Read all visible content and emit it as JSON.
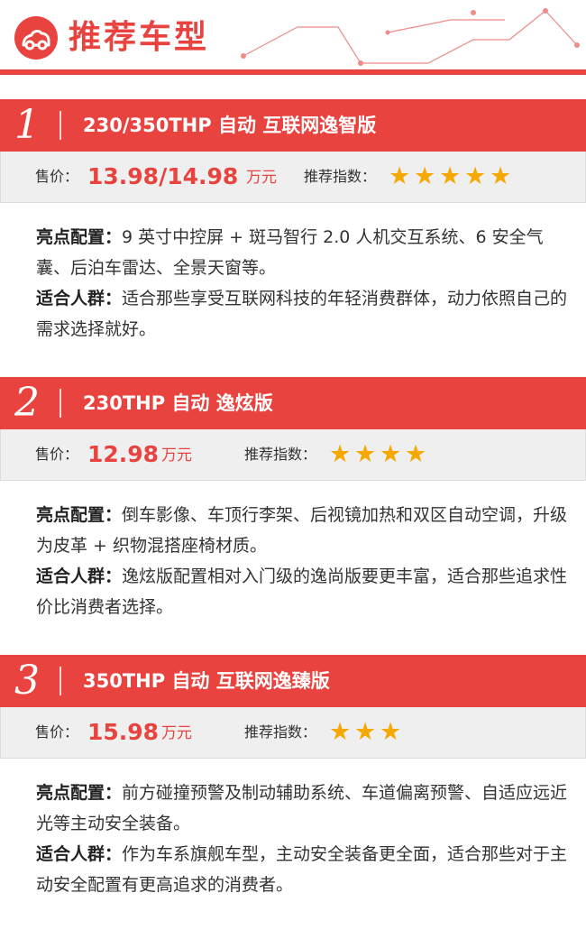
{
  "header": {
    "title": "推荐车型"
  },
  "colors": {
    "accent": "#e8433f",
    "star": "#f5a800"
  },
  "sections": [
    {
      "number": "1",
      "trim": "230/350THP 自动 互联网逸智版",
      "price_label": "售价：",
      "price": "13.98/14.98",
      "price_unit": "万元",
      "rating_label": "推荐指数：",
      "stars": 5,
      "highlight_label": "亮点配置：",
      "highlight_text": "9 英寸中控屏 + 斑马智行 2.0 人机交互系统、6 安全气囊、后泊车雷达、全景天窗等。",
      "audience_label": "适合人群：",
      "audience_text": "适合那些享受互联网科技的年轻消费群体，动力依照自己的需求选择就好。"
    },
    {
      "number": "2",
      "trim": "230THP 自动 逸炫版",
      "price_label": "售价：",
      "price": "12.98",
      "price_unit": "万元",
      "rating_label": "推荐指数：",
      "stars": 4,
      "highlight_label": "亮点配置：",
      "highlight_text": "倒车影像、车顶行李架、后视镜加热和双区自动空调，升级为皮革 + 织物混搭座椅材质。",
      "audience_label": "适合人群：",
      "audience_text": "逸炫版配置相对入门级的逸尚版要更丰富，适合那些追求性价比消费者选择。"
    },
    {
      "number": "3",
      "trim": "350THP 自动 互联网逸臻版",
      "price_label": "售价：",
      "price": "15.98",
      "price_unit": "万元",
      "rating_label": "推荐指数：",
      "stars": 3,
      "highlight_label": "亮点配置：",
      "highlight_text": "前方碰撞预警及制动辅助系统、车道偏离预警、自适应远近光等主动安全装备。",
      "audience_label": "适合人群：",
      "audience_text": "作为车系旗舰车型，主动安全装备更全面，适合那些对于主动安全配置有更高追求的消费者。"
    }
  ]
}
